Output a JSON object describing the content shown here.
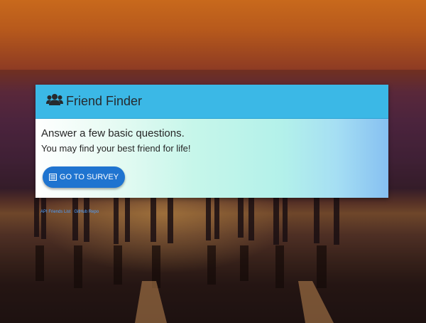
{
  "brand": {
    "title": "Friend Finder",
    "icon": "users-icon"
  },
  "hero": {
    "headline": "Answer a few basic questions.",
    "subline": "You may find your best friend for life!"
  },
  "survey_button": {
    "label": "GO TO SURVEY",
    "icon": "list-icon"
  },
  "footer_links": [
    {
      "label": "API Friends List"
    },
    {
      "label": "GitHub Repo"
    }
  ],
  "colors": {
    "header": "#3bb8e6",
    "button": "#1f74d0",
    "link": "#4da0ff"
  }
}
